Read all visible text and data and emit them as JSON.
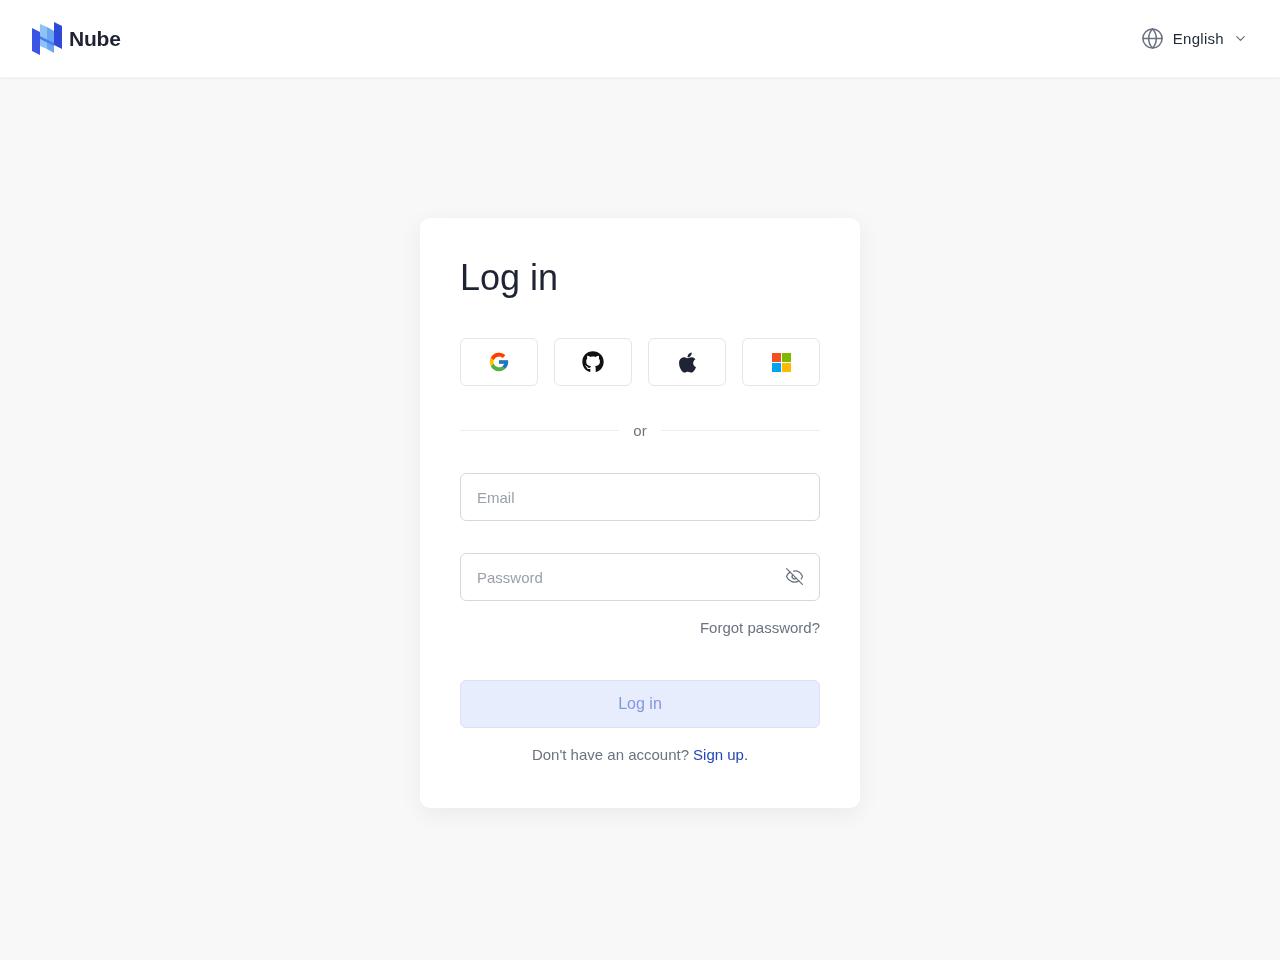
{
  "header": {
    "logo": {
      "name": "Nube"
    },
    "language": {
      "label": "English"
    }
  },
  "login_card": {
    "title": "Log in",
    "social_buttons": [
      {
        "kind": "google"
      },
      {
        "kind": "github"
      },
      {
        "kind": "apple"
      },
      {
        "kind": "microsoft"
      }
    ],
    "divider": "or",
    "fields": [
      {
        "kind": "email",
        "placeholder": "Email"
      },
      {
        "kind": "password",
        "placeholder": "Password",
        "visible": false
      }
    ],
    "forgot_link": "Forgot password?",
    "submit": {
      "label": "Log in",
      "disabled": true
    },
    "signup": {
      "prompt": "Don't have an account?",
      "link": "Sign up."
    }
  }
}
